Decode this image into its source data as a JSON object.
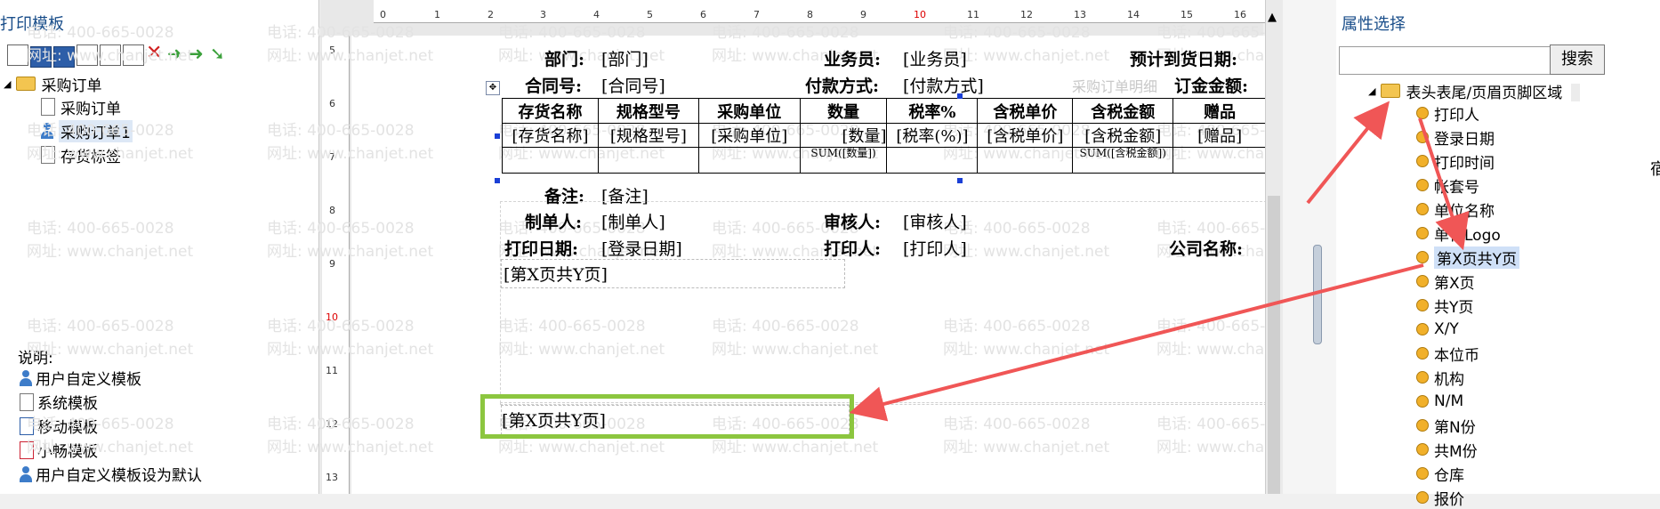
{
  "left_panel": {
    "title": "打印模板",
    "tree": {
      "root": "采购订单",
      "children": [
        "采购订单",
        "采购订单1",
        "存货标签"
      ]
    },
    "legend": {
      "title": "说明:",
      "items": [
        "用户自定义模板",
        "系统模板",
        "移动模板",
        "小畅模板",
        "用户自定义模板设为默认"
      ]
    }
  },
  "watermark": {
    "phone": "电话: 400-665-0028",
    "site": "网址: www.chanjet.net"
  },
  "ruler": {
    "top": [
      "0",
      "1",
      "2",
      "3",
      "4",
      "5",
      "6",
      "7",
      "8",
      "9",
      "10",
      "11",
      "12",
      "13",
      "14",
      "15",
      "16"
    ],
    "left": [
      "5",
      "6",
      "7",
      "8",
      "9",
      "10",
      "11",
      "12",
      "13"
    ]
  },
  "form": {
    "row1": {
      "dept_label": "部门:",
      "dept_field": "[部门]",
      "sales_label": "业务员:",
      "sales_field": "[业务员]",
      "eta_label": "预计到货日期:"
    },
    "row2": {
      "contract_label": "合同号:",
      "contract_field": "[合同号]",
      "pay_label": "付款方式:",
      "pay_field": "[付款方式]",
      "ghost": "采购订单明细",
      "amount_label": "订金金额:"
    },
    "table_headers": [
      "存货名称",
      "规格型号",
      "采购单位",
      "数量",
      "税率%",
      "含税单价",
      "含税金额",
      "赠品"
    ],
    "table_row": [
      "[存货名称]",
      "[规格型号]",
      "[采购单位]",
      "[数量]",
      "[税率(%)]",
      "[含税单价]",
      "[含税金额]",
      "[赠品]"
    ],
    "sum_row": [
      "",
      "",
      "",
      "SUM([数量])",
      "",
      "",
      "SUM([含税金额])",
      ""
    ],
    "remark_label": "备注:",
    "remark_field": "[备注]",
    "maker_label": "制单人:",
    "maker_field": "[制单人]",
    "auditor_label": "审核人:",
    "auditor_field": "[审核人]",
    "print_date_label": "打印日期:",
    "print_date_field": "[登录日期]",
    "printer_label": "打印人:",
    "printer_field": "[打印人]",
    "company_label": "公司名称:",
    "page_field": "[第X页共Y页]",
    "footer_page_field": "[第X页共Y页]"
  },
  "right_panel": {
    "title": "属性选择",
    "search_placeholder": "",
    "search_button": "搜索",
    "group": "表头表尾/页眉页脚区域",
    "items": [
      "打印人",
      "登录日期",
      "打印时间",
      "帐套号",
      "单位名称",
      "单位Logo",
      "第X页共Y页",
      "第X页",
      "共Y页",
      "X/Y",
      "本位币",
      "机构",
      "N/M",
      "第N份",
      "共M份",
      "仓库",
      "报价"
    ]
  },
  "colors": {
    "highlight": "#8cc63f",
    "arrow": "#f05656",
    "link": "#1a4e8a"
  }
}
